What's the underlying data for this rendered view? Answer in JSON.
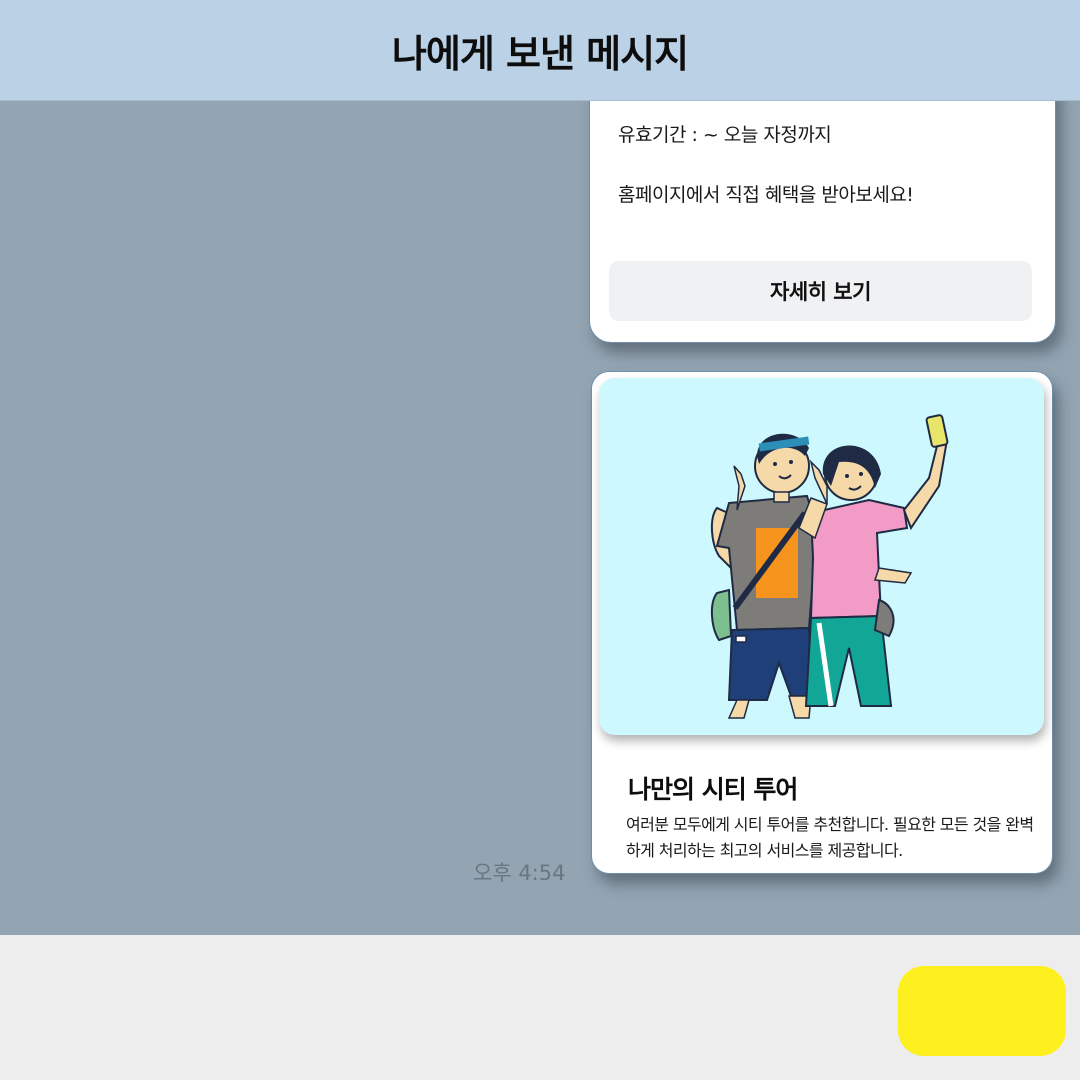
{
  "header": {
    "title": "나에게 보낸 메시지"
  },
  "coupon_card": {
    "validity": "유효기간 : ~ 오늘 자정까지",
    "body": "홈페이지에서 직접 혜택을 받아보세요!",
    "button_label": "자세히 보기"
  },
  "tour_card": {
    "title": "나만의 시티 투어",
    "description": "여러분 모두에게 시티 투어를 추천합니다. 필요한 모든 것을 완벽하게 처리하는 최고의 서비스를 제공합니다.",
    "image_icon": "selfie-couple-illustration"
  },
  "message": {
    "timestamp": "오후 4:54"
  },
  "colors": {
    "header_bg": "#bad1e6",
    "chat_bg": "#93a5b3",
    "image_bg": "#cdf8fd",
    "send_button": "#fef01e"
  }
}
